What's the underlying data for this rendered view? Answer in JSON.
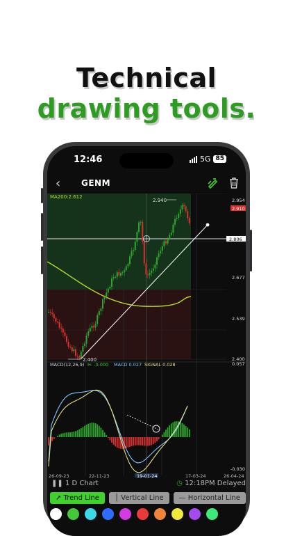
{
  "headline": {
    "line1": "Technical",
    "line2": "drawing tools."
  },
  "status_bar": {
    "time": "12:46",
    "network": "5G",
    "battery": "85"
  },
  "nav": {
    "back_icon": "chevron-left-icon",
    "ticker": "GENM",
    "draw_icon": "pen-icon",
    "delete_icon": "trash-icon"
  },
  "chart": {
    "ma_label": "MA200:2.612",
    "high_label": "2.940",
    "low_label": "2.400",
    "price_axis": [
      "2.954",
      "2.910",
      "2.806",
      "2.677",
      "2.539",
      "2.400",
      "0.057",
      "-0.030"
    ],
    "macd": {
      "title": "MACD(12,26,9)",
      "h": "H: -0.000",
      "macd": "MACD 0.027",
      "signal": "SIGNAL 0.028"
    },
    "date_axis": [
      "26-09-23",
      "22-11-23",
      "19-01-24",
      "17-03-24",
      "26-04-24"
    ],
    "colors": {
      "up": "#2ea52e",
      "down": "#d93030",
      "ma": "#b8dc2a",
      "macd_line": "#7fc7ff",
      "signal_line": "#e6e08a"
    }
  },
  "footer": {
    "period": "1 D Chart",
    "delay": "12:18PM Delayed"
  },
  "tools": [
    "Trend Line",
    "Vertical Line",
    "Horizontal Line"
  ],
  "swatches": [
    "#ffffff",
    "#45c83a",
    "#3cd9e8",
    "#2f6bff",
    "#d33be0",
    "#e83a3a",
    "#f0843a",
    "#f2ea3a",
    "#a14bf0",
    "#3ee87a"
  ]
}
